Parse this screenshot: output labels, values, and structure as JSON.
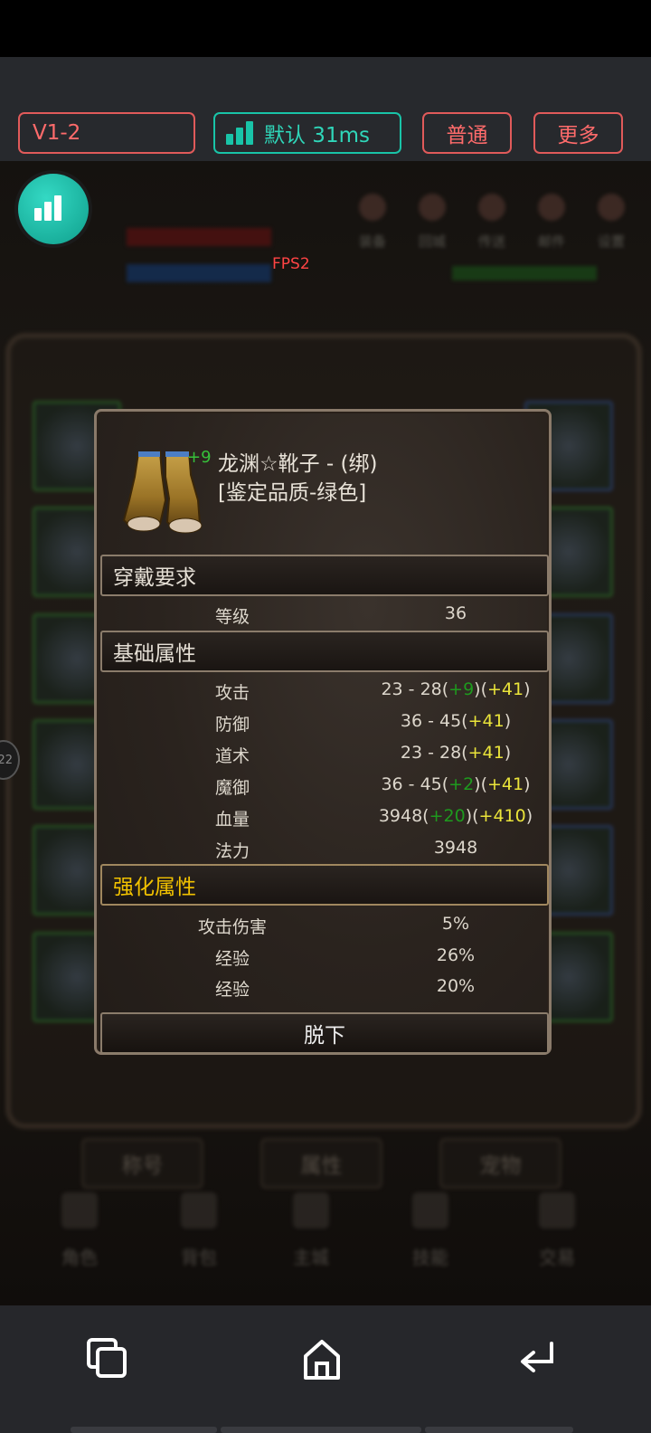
{
  "toolbar": {
    "version_label": "V1-2",
    "ping_label": "默认 31ms",
    "mode_label": "普通",
    "more_label": "更多"
  },
  "overlay": {
    "fps_label": "FPS2",
    "side_badge": "22"
  },
  "scene": {
    "top_menu": [
      "装备",
      "回城",
      "传送",
      "邮件",
      "设置"
    ],
    "tabs": [
      "称号",
      "属性",
      "宠物"
    ],
    "bottom_nav": [
      "角色",
      "背包",
      "主城",
      "技能",
      "交易"
    ]
  },
  "item": {
    "enhance_level": "+9",
    "name": "龙渊☆靴子 - (绑)",
    "quality": "[鉴定品质-绿色]"
  },
  "sections": {
    "requirements": "穿戴要求",
    "base_stats": "基础属性",
    "enhanced_stats": "强化属性"
  },
  "requirement_row": {
    "label": "等级",
    "value": "36"
  },
  "base_rows": [
    {
      "label": "攻击",
      "base": "23 - 28(",
      "green": "+9",
      "mid": ")(",
      "yellow": "+41",
      "end": ")"
    },
    {
      "label": "防御",
      "base": "36 - 45(",
      "green": "",
      "mid": "",
      "yellow": "+41",
      "end": ")"
    },
    {
      "label": "道术",
      "base": "23 - 28(",
      "green": "",
      "mid": "",
      "yellow": "+41",
      "end": ")"
    },
    {
      "label": "魔御",
      "base": "36 - 45(",
      "green": "+2",
      "mid": ")(",
      "yellow": "+41",
      "end": ")"
    },
    {
      "label": "血量",
      "base": "3948(",
      "green": "+20",
      "mid": ")(",
      "yellow": "+410",
      "end": ")"
    },
    {
      "label": "法力",
      "base": "3948",
      "green": "",
      "mid": "",
      "yellow": "",
      "end": ""
    }
  ],
  "enhanced_rows": [
    {
      "label": "攻击伤害",
      "value": "5%"
    },
    {
      "label": "经验",
      "value": "26%"
    },
    {
      "label": "经验",
      "value": "20%"
    }
  ],
  "unequip_label": "脱下",
  "system_nav": {
    "icons": [
      "recent-apps-icon",
      "home-icon",
      "back-icon"
    ]
  },
  "colors": {
    "accent_teal": "#19c4a8",
    "accent_red": "#e05a5a",
    "stat_green": "#1e9a1e",
    "stat_yellow": "#eae43a",
    "section_gold": "#f2c200"
  }
}
